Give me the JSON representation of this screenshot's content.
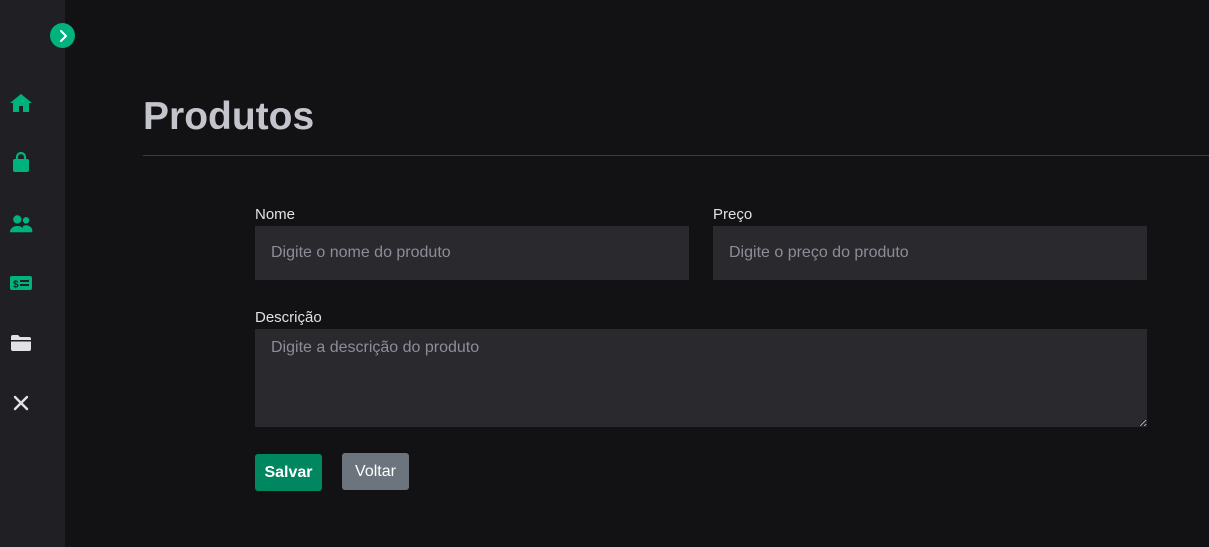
{
  "sidebar": {
    "toggle_icon": "chevron-right-icon",
    "items": [
      {
        "icon": "home-icon"
      },
      {
        "icon": "shopping-bag-icon"
      },
      {
        "icon": "users-icon"
      },
      {
        "icon": "money-bill-icon"
      },
      {
        "icon": "folder-icon"
      },
      {
        "icon": "close-icon"
      }
    ],
    "icon_color": "#00b37e"
  },
  "page": {
    "title": "Produtos"
  },
  "form": {
    "nome": {
      "label": "Nome",
      "placeholder": "Digite o nome do produto",
      "value": ""
    },
    "preco": {
      "label": "Preço",
      "placeholder": "Digite o preço do produto",
      "value": ""
    },
    "descricao": {
      "label": "Descrição",
      "placeholder": "Digite a descrição do produto",
      "value": ""
    },
    "save_label": "Salvar",
    "back_label": "Voltar"
  },
  "colors": {
    "accent": "#00b37e",
    "save_button": "#00875f",
    "back_button": "#6c757d",
    "background": "#121214",
    "sidebar": "#202024",
    "input": "#29292e"
  }
}
